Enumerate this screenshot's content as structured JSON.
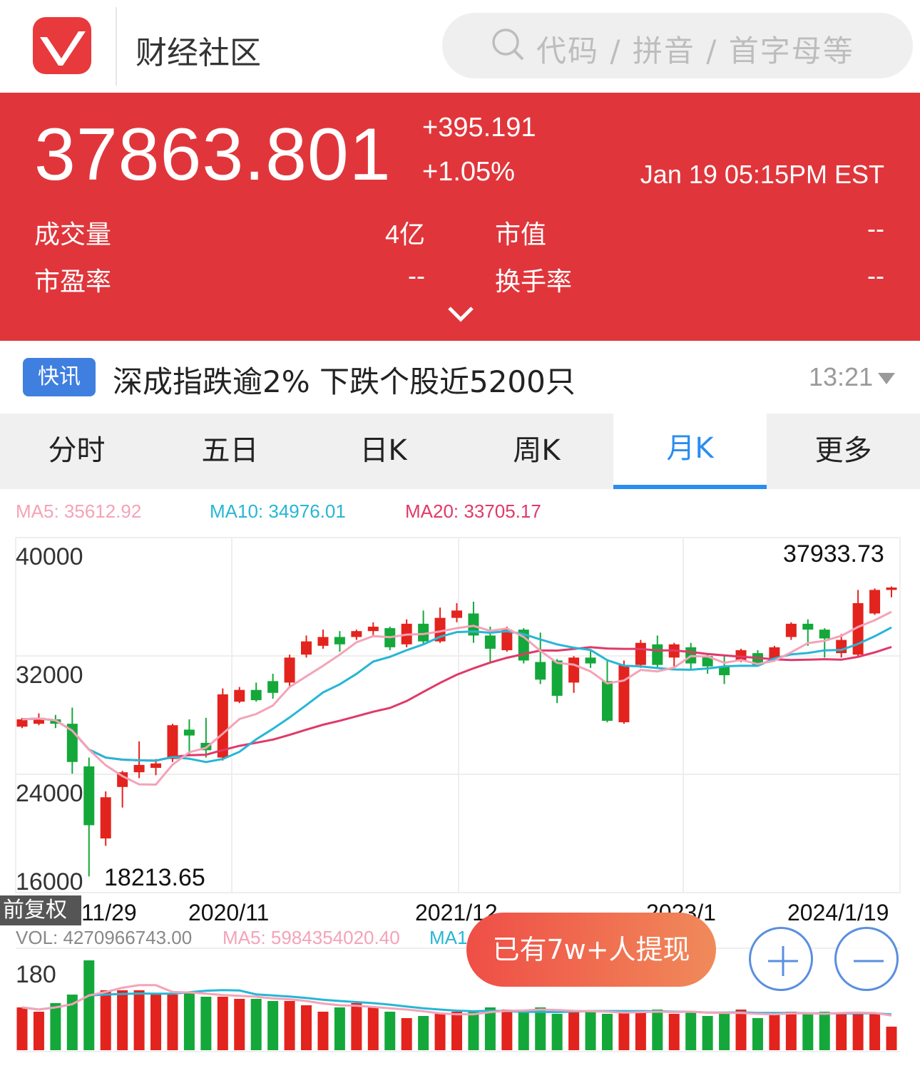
{
  "header": {
    "app_title": "财经社区",
    "search_placeholder": "代码 / 拼音 / 首字母等"
  },
  "quote": {
    "price": "37863.801",
    "change": "+395.191",
    "change_pct": "+1.05%",
    "time": "Jan 19 05:15PM EST",
    "stats": [
      {
        "label": "成交量",
        "value": "4亿"
      },
      {
        "label": "市值",
        "value": "--"
      },
      {
        "label": "市盈率",
        "value": "--"
      },
      {
        "label": "换手率",
        "value": "--"
      }
    ],
    "colors": {
      "background": "#e0363b"
    }
  },
  "news": {
    "badge": "快讯",
    "headline": "深成指跌逾2%  下跌个股近5200只",
    "time": "13:21"
  },
  "tabs": [
    {
      "label": "分时",
      "active": false
    },
    {
      "label": "五日",
      "active": false
    },
    {
      "label": "日K",
      "active": false
    },
    {
      "label": "周K",
      "active": false
    },
    {
      "label": "月K",
      "active": true
    },
    {
      "label": "更多",
      "active": false
    }
  ],
  "ma_legend": {
    "ma5": "MA5: 35612.92",
    "ma10": "MA10: 34976.01",
    "ma20": "MA20: 33705.17",
    "colors": {
      "ma5": "#f4a3b8",
      "ma10": "#27b6d6",
      "ma20": "#e0396a"
    }
  },
  "price_chart": {
    "y_ticks": [
      "40000",
      "32000",
      "24000",
      "16000"
    ],
    "high_label": "37933.73",
    "low_label": "18213.65",
    "adjust_label": "前复权",
    "x_labels": [
      "11/29",
      "2020/11",
      "2021/12",
      "2023/1",
      "2024/1/19"
    ]
  },
  "volume": {
    "vol": "VOL: 4270966743.00",
    "ma5": "MA5: 5984354020.40",
    "ma10_partial": "MA1",
    "y_tick": "180"
  },
  "promo": {
    "label": "已有7w+人提现"
  },
  "chart_data": {
    "type": "candlestick",
    "y_range": [
      16000,
      40000
    ],
    "candles": [
      [
        28400,
        28900,
        28300,
        29000
      ],
      [
        28600,
        29000,
        28500,
        29300
      ],
      [
        28900,
        28600,
        28300,
        29200
      ],
      [
        28600,
        26000,
        25200,
        29700
      ],
      [
        25700,
        21700,
        18213.65,
        26300
      ],
      [
        20800,
        23600,
        20300,
        24000
      ],
      [
        24300,
        25300,
        22900,
        25400
      ],
      [
        25300,
        25800,
        24900,
        27400
      ],
      [
        25600,
        25900,
        25100,
        26200
      ],
      [
        26200,
        28500,
        26000,
        28600
      ],
      [
        28200,
        27800,
        26400,
        28900
      ],
      [
        27300,
        26800,
        26300,
        29000
      ],
      [
        26300,
        30600,
        26100,
        31000
      ],
      [
        30100,
        30900,
        30000,
        31100
      ],
      [
        30900,
        30200,
        30100,
        31400
      ],
      [
        31500,
        30700,
        30300,
        32000
      ],
      [
        31400,
        33100,
        31100,
        33300
      ],
      [
        33300,
        34200,
        33100,
        34600
      ],
      [
        33900,
        34500,
        33700,
        35000
      ],
      [
        34500,
        34000,
        33500,
        34900
      ],
      [
        34500,
        34900,
        34300,
        35000
      ],
      [
        34900,
        35200,
        34600,
        35500
      ],
      [
        35100,
        33800,
        33600,
        35200
      ],
      [
        34000,
        35400,
        33800,
        35700
      ],
      [
        35400,
        34200,
        34000,
        36300
      ],
      [
        34200,
        35800,
        34100,
        36500
      ],
      [
        35800,
        36300,
        35500,
        36800
      ],
      [
        36100,
        34600,
        34100,
        36900
      ],
      [
        34600,
        33700,
        32800,
        35200
      ],
      [
        33600,
        35000,
        33500,
        35200
      ],
      [
        35000,
        32900,
        32700,
        35100
      ],
      [
        32800,
        31600,
        31300,
        34800
      ],
      [
        32900,
        30500,
        30000,
        33000
      ],
      [
        31400,
        33100,
        30700,
        33200
      ],
      [
        33100,
        32700,
        32400,
        33600
      ],
      [
        31500,
        28800,
        28700,
        33000
      ],
      [
        28700,
        32600,
        28600,
        32900
      ],
      [
        32600,
        34100,
        32400,
        34300
      ],
      [
        34000,
        32600,
        32400,
        34600
      ],
      [
        33100,
        34000,
        32500,
        34100
      ],
      [
        33800,
        32700,
        32300,
        34100
      ],
      [
        33200,
        32500,
        32000,
        33400
      ],
      [
        32500,
        31900,
        31300,
        33200
      ],
      [
        32900,
        33600,
        32800,
        33700
      ],
      [
        33400,
        32600,
        32500,
        33600
      ],
      [
        33000,
        33800,
        32900,
        33900
      ],
      [
        34500,
        35400,
        34300,
        35500
      ],
      [
        35400,
        35000,
        33900,
        35700
      ],
      [
        35000,
        34400,
        33100,
        35100
      ],
      [
        33400,
        34300,
        33100,
        34700
      ],
      [
        33300,
        36800,
        33100,
        37700
      ],
      [
        36100,
        37700,
        36000,
        37800
      ],
      [
        37700,
        37863.8,
        37200,
        37933.73
      ]
    ],
    "volume_candle_aligned": [
      1.0,
      0.9,
      1.1,
      1.3,
      2.1,
      1.4,
      1.4,
      1.4,
      1.3,
      1.3,
      1.35,
      1.25,
      1.25,
      1.2,
      1.2,
      1.15,
      1.15,
      1.05,
      0.9,
      1.0,
      1.1,
      1.0,
      0.9,
      0.75,
      0.8,
      0.85,
      0.9,
      0.9,
      1.0,
      0.95,
      0.9,
      1.0,
      0.85,
      0.9,
      0.9,
      0.85,
      0.9,
      0.9,
      0.95,
      0.85,
      0.9,
      0.8,
      0.85,
      0.95,
      0.75,
      0.85,
      0.9,
      0.85,
      0.9,
      0.85,
      0.9,
      0.85,
      0.55
    ],
    "colors": {
      "up": "#e3231d",
      "down": "#14a83a"
    }
  }
}
